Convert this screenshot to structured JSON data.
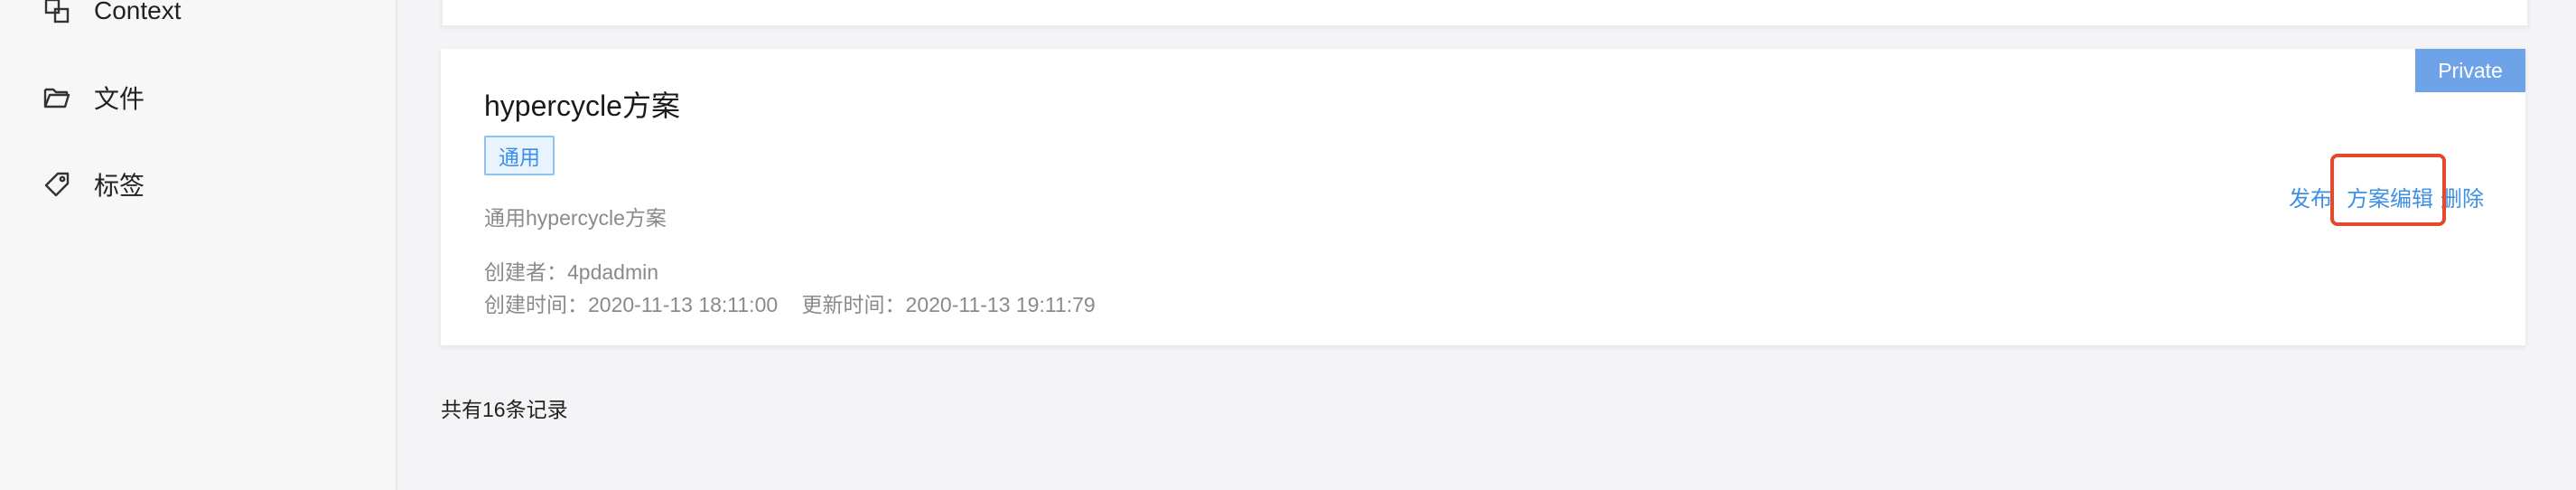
{
  "sidebar": {
    "items": [
      {
        "label": "Context",
        "icon": "context-icon"
      },
      {
        "label": "文件",
        "icon": "folder-icon"
      },
      {
        "label": "标签",
        "icon": "tag-icon"
      }
    ]
  },
  "card": {
    "badge": "Private",
    "title": "hypercycle方案",
    "tag": "通用",
    "description": "通用hypercycle方案",
    "creator": "创建者：4pdadmin",
    "created_time": "创建时间：2020-11-13 18:11:00",
    "updated_time": "更新时间：2020-11-13 19:11:79",
    "actions": {
      "publish": "发布",
      "edit": "方案编辑",
      "delete": "删除"
    }
  },
  "footer": {
    "total": "共有16条记录"
  },
  "colors": {
    "accent": "#3f8fe3",
    "badge_bg": "#6fa3e8",
    "highlight": "#e24a2b"
  }
}
